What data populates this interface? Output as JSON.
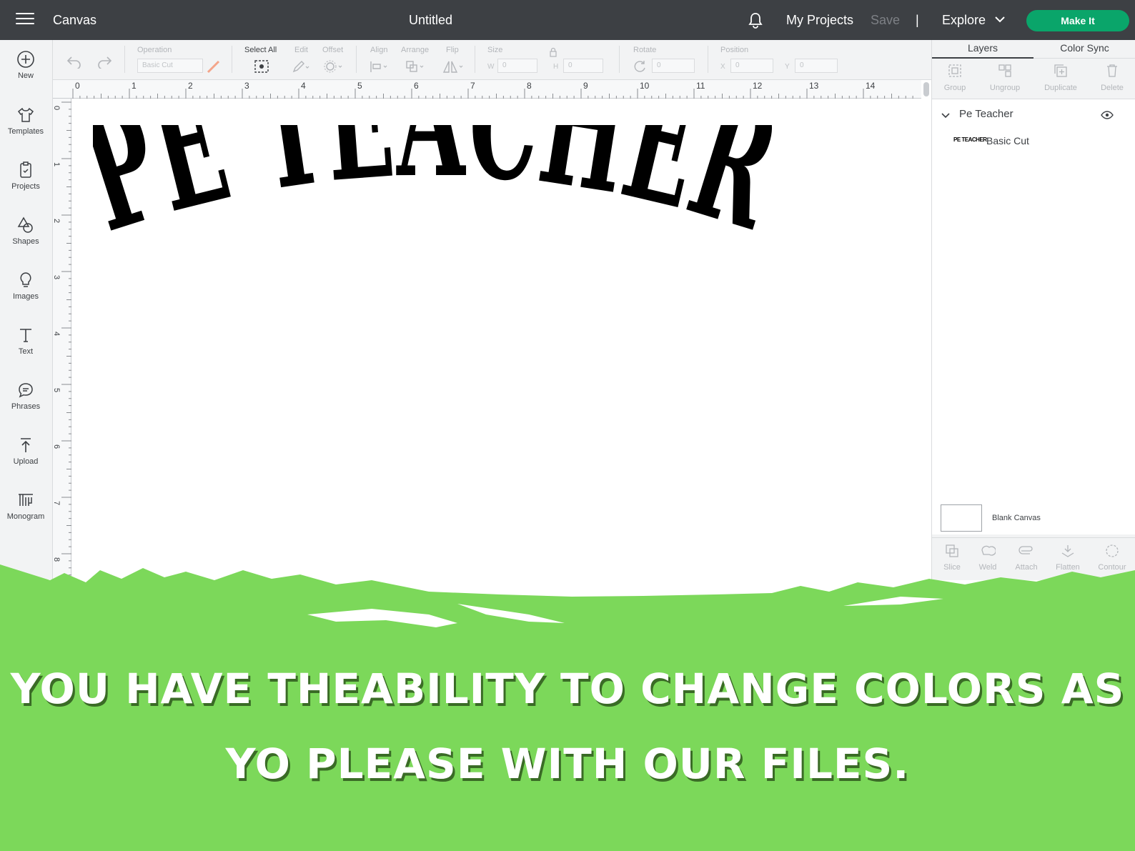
{
  "header": {
    "app_name": "Canvas",
    "doc_title": "Untitled",
    "my_projects": "My Projects",
    "save": "Save",
    "separator": "|",
    "explore": "Explore",
    "make_it": "Make It"
  },
  "sidebar": {
    "items": [
      {
        "label": "New",
        "icon": "plus-circle-icon"
      },
      {
        "label": "Templates",
        "icon": "shirt-icon"
      },
      {
        "label": "Projects",
        "icon": "clipboard-icon"
      },
      {
        "label": "Shapes",
        "icon": "shapes-icon"
      },
      {
        "label": "Images",
        "icon": "lightbulb-icon"
      },
      {
        "label": "Text",
        "icon": "text-icon"
      },
      {
        "label": "Phrases",
        "icon": "speech-bubble-icon"
      },
      {
        "label": "Upload",
        "icon": "upload-icon"
      },
      {
        "label": "Monogram",
        "icon": "monogram-icon"
      }
    ]
  },
  "toolbar": {
    "operation_label": "Operation",
    "operation_value": "Basic Cut",
    "select_all": "Select All",
    "edit": "Edit",
    "offset": "Offset",
    "align": "Align",
    "arrange": "Arrange",
    "flip": "Flip",
    "size": "Size",
    "w": "W",
    "h": "H",
    "w_value": "0",
    "h_value": "0",
    "rotate": "Rotate",
    "rotate_value": "0",
    "position": "Position",
    "x": "X",
    "y": "Y",
    "x_value": "0",
    "y_value": "0"
  },
  "ruler": {
    "h": [
      "0",
      "1",
      "2",
      "3",
      "4",
      "5",
      "6",
      "7",
      "8",
      "9",
      "10",
      "11",
      "12",
      "13",
      "14"
    ],
    "v": [
      "0",
      "1",
      "2",
      "3",
      "4",
      "5",
      "6",
      "7",
      "8"
    ]
  },
  "canvas": {
    "artwork_text": "PE TEACHER"
  },
  "panel": {
    "tab_layers": "Layers",
    "tab_color_sync": "Color Sync",
    "actions": [
      "Group",
      "Ungroup",
      "Duplicate",
      "Delete"
    ],
    "layer_group": "Pe Teacher",
    "layer_thumb": "PE TEACHER",
    "layer_item": "Basic Cut",
    "blank_canvas": "Blank Canvas",
    "bottom_actions": [
      "Slice",
      "Weld",
      "Attach",
      "Flatten",
      "Contour"
    ]
  },
  "banner": {
    "line1": "YOU HAVE THEABILITY TO CHANGE COLORS AS",
    "line2": "YO PLEASE WITH OUR FILES.",
    "color": "#7cd85a"
  }
}
